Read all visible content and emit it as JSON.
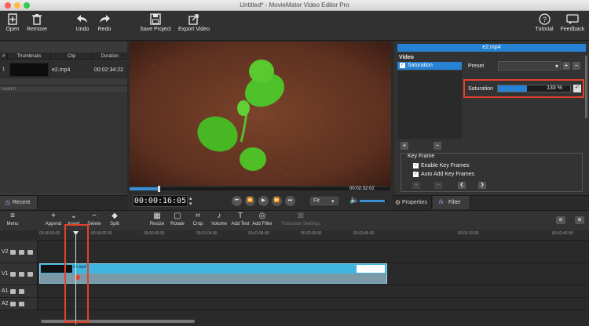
{
  "window": {
    "title": "Untitled* - MovieMator Video Editor Pro"
  },
  "toolbar": {
    "open": "Open",
    "remove": "Remove",
    "undo": "Undo",
    "redo": "Redo",
    "save_project": "Save Project",
    "export_video": "Export Video",
    "tutorial": "Tutorial",
    "feedback": "Feedback"
  },
  "media": {
    "columns": [
      "#",
      "Thumbnails",
      "Clip",
      "Duration"
    ],
    "rows": [
      {
        "index": "1",
        "clip": "e2.mp4",
        "duration": "00:02:34:22"
      }
    ],
    "search_placeholder": "search",
    "tab_recent": "Recent"
  },
  "player": {
    "timecode": "00:00:16:05",
    "duration": "00:02:32:02",
    "zoom": "Fit",
    "progress_fraction": 0.11,
    "volume_fraction": 0.95
  },
  "filter_panel": {
    "clip_name": "e2.mp4",
    "section": "Video",
    "filters": [
      {
        "label": "Saturation",
        "checked": true
      }
    ],
    "preset_label": "Preset",
    "saturation_label": "Saturation",
    "saturation_value": "133 %",
    "saturation_fraction": 0.4,
    "keyframe_title": "Key Frame",
    "enable_keyframes": "Enable Key Frames",
    "auto_add_keyframes": "Auto Add Key Frames",
    "tab_properties": "Properties",
    "tab_filter": "Filter",
    "fx_label": "fx"
  },
  "timeline_tools": [
    {
      "id": "menu",
      "label": "Menu",
      "icon": "≡"
    },
    {
      "id": "append",
      "label": "Append",
      "icon": "+"
    },
    {
      "id": "insert",
      "label": "Insert",
      "icon": "⌄"
    },
    {
      "id": "delete",
      "label": "Delete",
      "icon": "−"
    },
    {
      "id": "split",
      "label": "Split",
      "icon": "◆"
    },
    {
      "id": "resize",
      "label": "Resize",
      "icon": "▦"
    },
    {
      "id": "rotate",
      "label": "Rotate",
      "icon": "▢"
    },
    {
      "id": "crop",
      "label": "Crop",
      "icon": "⌗"
    },
    {
      "id": "volume",
      "label": "Volume",
      "icon": "♪"
    },
    {
      "id": "add_text",
      "label": "Add Text",
      "icon": "T"
    },
    {
      "id": "add_filter",
      "label": "Add Filter",
      "icon": "◎"
    },
    {
      "id": "transition",
      "label": "Transition Settings",
      "icon": "⊠"
    }
  ],
  "ruler": [
    "00:00:00:00",
    "00:00:02:00",
    "00:00:50:00",
    "00:01:04:00",
    "00:01:08:00",
    "00:02:00:00",
    "00:02:45:00",
    "00:02:10:00",
    "00:02:44:00"
  ],
  "tracks": [
    "V2",
    "V1",
    "A1",
    "A2"
  ],
  "clip_label": "e2.mp4"
}
